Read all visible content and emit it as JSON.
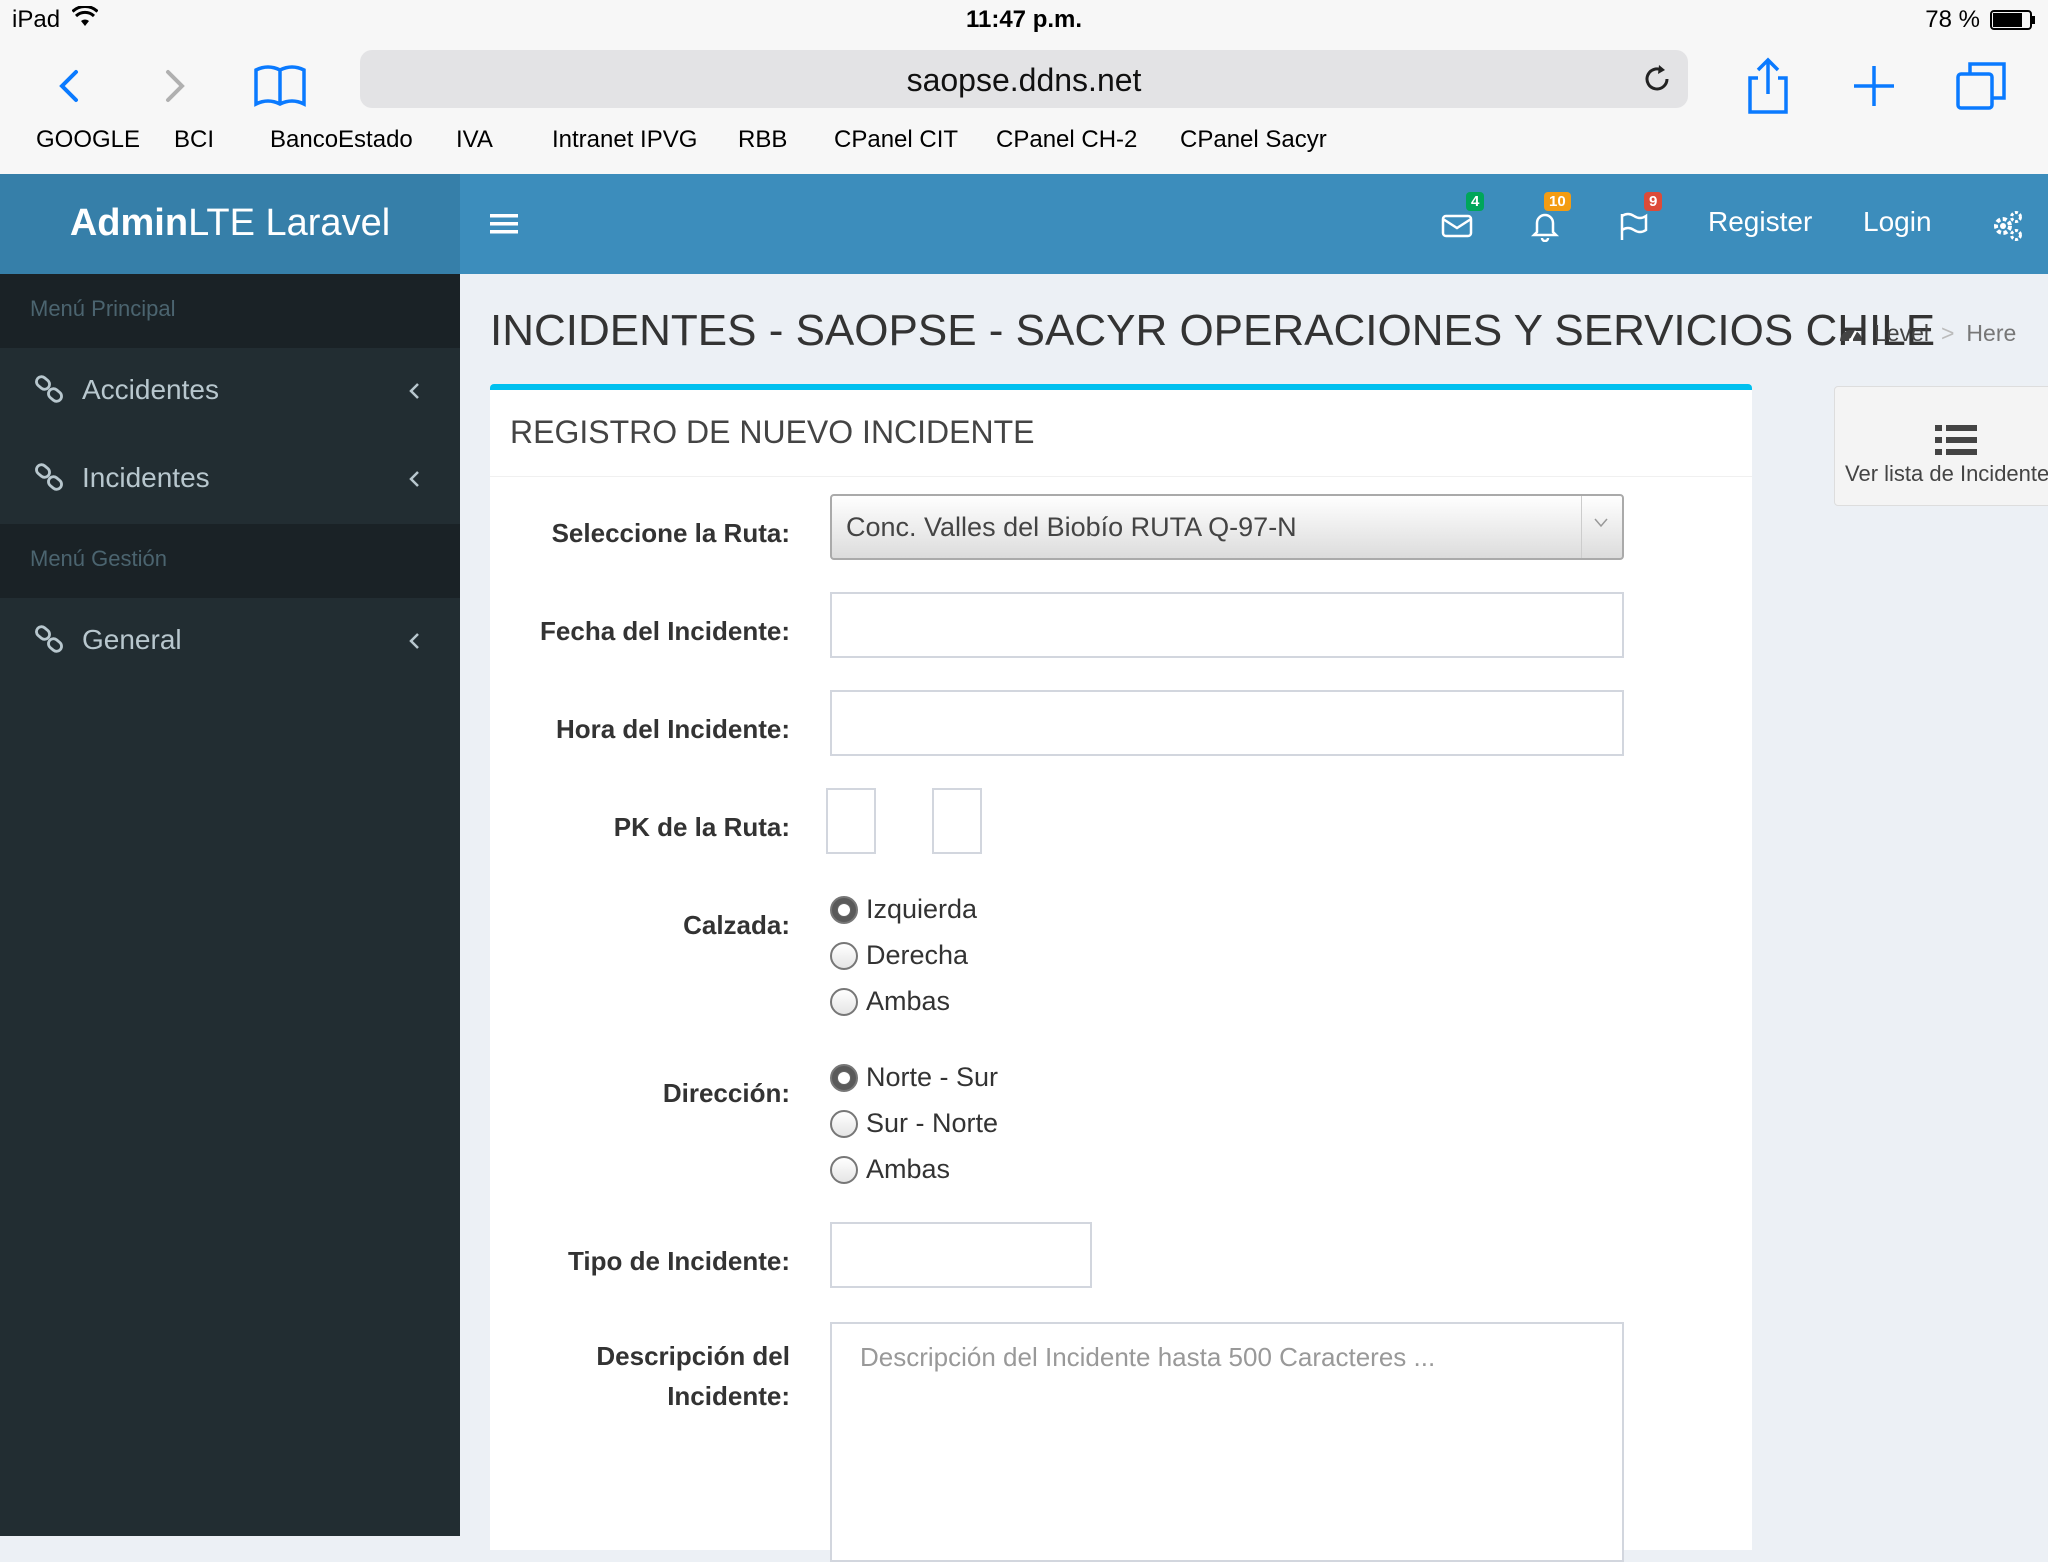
{
  "status_bar": {
    "device": "iPad",
    "time": "11:47 p.m.",
    "battery": "78 %"
  },
  "browser": {
    "url": "saopse.ddns.net",
    "bookmarks": [
      "GOOGLE",
      "BCI",
      "BancoEstado",
      "IVA",
      "Intranet IPVG",
      "RBB",
      "CPanel CIT",
      "CPanel CH-2",
      "CPanel Sacyr"
    ]
  },
  "header": {
    "logo_bold": "Admin",
    "logo_rest": "LTE Laravel",
    "badges": {
      "messages": "4",
      "notifications": "10",
      "tasks": "9"
    },
    "badge_colors": {
      "messages": "#00a65a",
      "notifications": "#f39c12",
      "tasks": "#dd4b39"
    },
    "register": "Register",
    "login": "Login"
  },
  "sidebar": {
    "header_main": "Menú Principal",
    "items_main": [
      "Accidentes",
      "Incidentes"
    ],
    "header_gestion": "Menú Gestión",
    "items_gestion": [
      "General"
    ]
  },
  "content": {
    "title": "INCIDENTES - SAOPSE - SACYR OPERACIONES Y SERVICIOS CHILE",
    "breadcrumb": [
      "Level",
      "Here"
    ],
    "side_button": "Ver lista de Incidentes"
  },
  "form": {
    "box_title": "REGISTRO DE NUEVO INCIDENTE",
    "labels": {
      "ruta": "Seleccione la Ruta:",
      "fecha": "Fecha del Incidente:",
      "hora": "Hora del Incidente:",
      "pk": "PK de la Ruta:",
      "calzada": "Calzada:",
      "direccion": "Dirección:",
      "tipo": "Tipo de Incidente:",
      "descripcion_1": "Descripción del",
      "descripcion_2": "Incidente:"
    },
    "ruta_selected": "Conc. Valles del Biobío RUTA Q-97-N",
    "calzada_options": [
      "Izquierda",
      "Derecha",
      "Ambas"
    ],
    "calzada_selected": "Izquierda",
    "direccion_options": [
      "Norte - Sur",
      "Sur - Norte",
      "Ambas"
    ],
    "direccion_selected": "Norte - Sur",
    "descripcion_placeholder": "Descripción del Incidente hasta 500 Caracteres ..."
  }
}
